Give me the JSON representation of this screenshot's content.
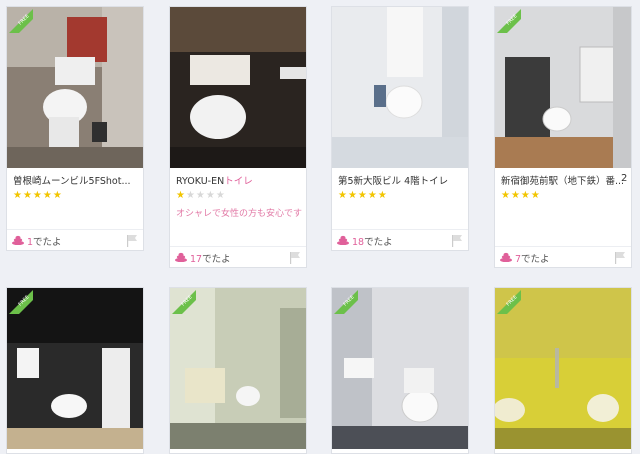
{
  "cards": [
    {
      "title_prefix": "曽根崎ムーンビル5FShot...",
      "title_highlight": "",
      "rank": "",
      "stars": 5,
      "comment": "",
      "count": "1",
      "count_suffix": "でたよ",
      "free": true
    },
    {
      "title_prefix": "RYOKU-EN",
      "title_highlight": "トイレ",
      "rank": "",
      "stars": 1,
      "comment": "オシャレで女性の方も安心です",
      "count": "17",
      "count_suffix": "でたよ",
      "free": false
    },
    {
      "title_prefix": "第5新大阪ビル 4階トイレ",
      "title_highlight": "",
      "rank": "",
      "stars": 5,
      "comment": "",
      "count": "18",
      "count_suffix": "でたよ",
      "free": false
    },
    {
      "title_prefix": "新宿御苑前駅（地下鉄）番...",
      "title_highlight": "",
      "rank": "2",
      "stars": 4,
      "comment": "",
      "count": "7",
      "count_suffix": "でたよ",
      "free": true
    },
    {
      "free": true
    },
    {
      "free": true
    },
    {
      "free": true
    },
    {
      "free": true
    }
  ],
  "free_label": "FREE",
  "icons": {
    "count": "poop-icon",
    "report": "flag-icon"
  },
  "colors": {
    "accent": "#e0609a",
    "star": "#f2c500",
    "free_badge": "#6cc04a"
  }
}
